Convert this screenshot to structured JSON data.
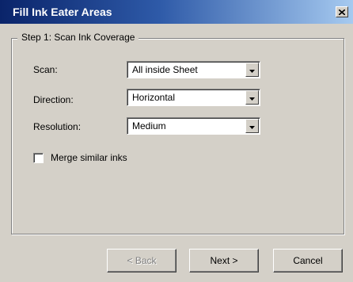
{
  "window": {
    "title": "Fill Ink Eater Areas",
    "close_symbol": "×"
  },
  "step": {
    "legend": "Step 1: Scan Ink Coverage"
  },
  "fields": [
    {
      "label": "Scan:",
      "value": "All inside Sheet"
    },
    {
      "label": "Direction:",
      "value": "Horizontal"
    },
    {
      "label": "Resolution:",
      "value": "Medium"
    }
  ],
  "merge": {
    "label": "Merge similar inks",
    "checked": false
  },
  "buttons": {
    "back": "< Back",
    "next": "Next >",
    "cancel": "Cancel"
  },
  "icons": {
    "close": "close-icon",
    "dropdown": "chevron-down-icon"
  },
  "colors": {
    "title_gradient_start": "#0a246a",
    "title_gradient_end": "#a6caf0",
    "face": "#d4d0c8"
  }
}
